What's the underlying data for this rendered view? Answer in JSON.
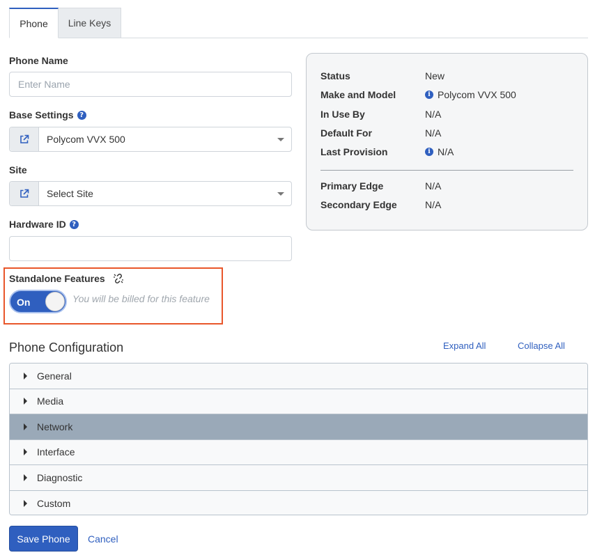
{
  "tabs": [
    {
      "label": "Phone"
    },
    {
      "label": "Line Keys"
    }
  ],
  "form": {
    "phone_name_label": "Phone Name",
    "phone_name_placeholder": "Enter Name",
    "base_settings_label": "Base Settings",
    "base_settings_value": "Polycom VVX 500",
    "site_label": "Site",
    "site_value": "Select Site",
    "hardware_id_label": "Hardware ID",
    "hardware_id_value": ""
  },
  "standalone": {
    "label": "Standalone Features",
    "toggle_label": "On",
    "toggle_on": true,
    "note": "You will be billed for this feature"
  },
  "status": {
    "rows": [
      {
        "key": "Status",
        "value": "New"
      },
      {
        "key": "Make and Model",
        "value": "Polycom VVX 500"
      },
      {
        "key": "In Use By",
        "value": "N/A"
      },
      {
        "key": "Default For",
        "value": "N/A"
      },
      {
        "key": "Last Provision",
        "value": "N/A"
      },
      {
        "key": "Primary Edge",
        "value": "N/A"
      },
      {
        "key": "Secondary Edge",
        "value": "N/A"
      }
    ]
  },
  "config": {
    "title": "Phone Configuration",
    "expand_all": "Expand All",
    "collapse_all": "Collapse All",
    "sections": [
      {
        "label": "General"
      },
      {
        "label": "Media"
      },
      {
        "label": "Network"
      },
      {
        "label": "Interface"
      },
      {
        "label": "Diagnostic"
      },
      {
        "label": "Custom"
      }
    ]
  },
  "actions": {
    "save": "Save Phone",
    "cancel": "Cancel"
  },
  "colors": {
    "accent": "#2f5fbf",
    "highlight_border": "#e8562a",
    "active_section": "#9aa9b8"
  }
}
